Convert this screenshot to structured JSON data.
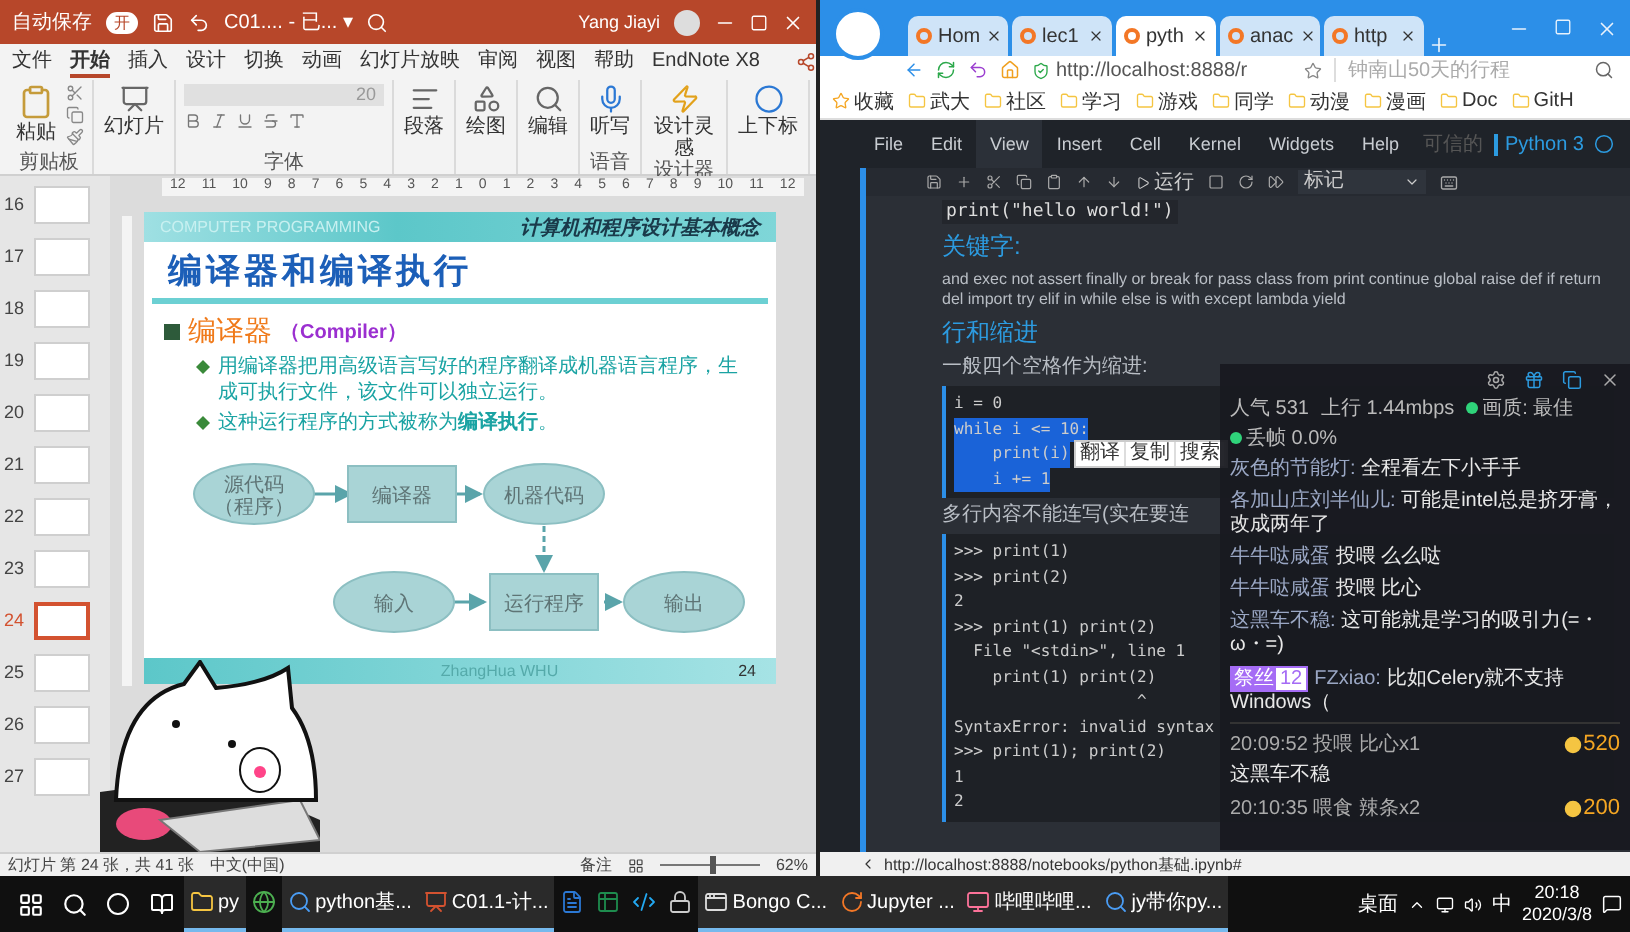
{
  "ppt": {
    "title_bar": {
      "autosave": "自动保存",
      "toggle_label": "开",
      "autosave_on": true,
      "document": "C01.... - 已... ▾",
      "user": "Yang Jiayi"
    },
    "menu_tabs": [
      {
        "label": "文件",
        "selected": false
      },
      {
        "label": "开始",
        "selected": true
      },
      {
        "label": "插入",
        "selected": false
      },
      {
        "label": "设计",
        "selected": false
      },
      {
        "label": "切换",
        "selected": false
      },
      {
        "label": "动画",
        "selected": false
      },
      {
        "label": "幻灯片放映",
        "selected": false
      },
      {
        "label": "审阅",
        "selected": false
      },
      {
        "label": "视图",
        "selected": false
      },
      {
        "label": "帮助",
        "selected": false
      },
      {
        "label": "EndNote X8",
        "selected": false
      }
    ],
    "ribbon": [
      {
        "kind": "clipboard",
        "button": "粘贴",
        "label": "剪贴板"
      },
      {
        "kind": "button",
        "button": "幻灯片"
      },
      {
        "kind": "font",
        "font_size": "20",
        "label": "字体"
      },
      {
        "kind": "button",
        "button": "段落"
      },
      {
        "kind": "button",
        "button": "绘图"
      },
      {
        "kind": "button",
        "button": "编辑"
      },
      {
        "kind": "button",
        "button": "听写",
        "label": "语音"
      },
      {
        "kind": "button",
        "button": "设计灵感",
        "label": "设计器"
      },
      {
        "kind": "button",
        "button": "上下标"
      }
    ],
    "ruler": [
      "12",
      "11",
      "10",
      "9",
      "8",
      "7",
      "6",
      "5",
      "4",
      "3",
      "2",
      "1",
      "0",
      "1",
      "2",
      "3",
      "4",
      "5",
      "6",
      "7",
      "8",
      "9",
      "10",
      "11",
      "12"
    ],
    "thumbnails": [
      {
        "number": "16",
        "selected": false
      },
      {
        "number": "17",
        "selected": false
      },
      {
        "number": "18",
        "selected": false
      },
      {
        "number": "19",
        "selected": false
      },
      {
        "number": "20",
        "selected": false
      },
      {
        "number": "21",
        "selected": false
      },
      {
        "number": "22",
        "selected": false
      },
      {
        "number": "23",
        "selected": false
      },
      {
        "number": "24",
        "selected": true
      },
      {
        "number": "25",
        "selected": false
      },
      {
        "number": "26",
        "selected": false
      },
      {
        "number": "27",
        "selected": false
      }
    ],
    "slide": {
      "banner": "COMPUTER PROGRAMMING",
      "course": "计算机和程序设计基本概念",
      "title": "编译器和编译执行",
      "heading": "编译器",
      "heading_en": "（Compiler）",
      "bullets": [
        "用编译器把用高级语言写好的程序翻译成机器语言程序，生成可执行文件，该文件可以独立运行。",
        "这种运行程序的方式被称为**编译执行**。"
      ],
      "diagram": {
        "nodes": [
          {
            "kind": "ellipse",
            "lines": [
              "源代码",
              "（程序）"
            ]
          },
          {
            "kind": "rect",
            "lines": [
              "编译器"
            ]
          },
          {
            "kind": "ellipse",
            "lines": [
              "机器代码"
            ]
          },
          {
            "kind": "ellipse",
            "lines": [
              "输入"
            ]
          },
          {
            "kind": "rect",
            "lines": [
              "运行程序"
            ]
          },
          {
            "kind": "ellipse",
            "lines": [
              "输出"
            ]
          }
        ]
      },
      "footer": "ZhangHua   WHU",
      "page": "24"
    },
    "status_bar": {
      "slide_info": "幻灯片 第 24 张，共 41 张",
      "language": "中文(中国)",
      "notes": "备注",
      "zoom": {
        "reading": "62%",
        "level": 0.5
      }
    }
  },
  "browser": {
    "tabs": [
      {
        "label": "Hom",
        "selected": false
      },
      {
        "label": "lec1",
        "selected": false
      },
      {
        "label": "pyth",
        "selected": true
      },
      {
        "label": "anac",
        "selected": false
      },
      {
        "label": "http",
        "selected": false
      }
    ],
    "url": "http://localhost:8888/r",
    "search_placeholder": "钟南山50天的行程",
    "bookmarks": [
      {
        "kind": "star",
        "label": "收藏"
      },
      {
        "kind": "folder",
        "label": "武大"
      },
      {
        "kind": "folder",
        "label": "社区"
      },
      {
        "kind": "folder",
        "label": "学习"
      },
      {
        "kind": "folder",
        "label": "游戏"
      },
      {
        "kind": "folder",
        "label": "同学"
      },
      {
        "kind": "folder",
        "label": "动漫"
      },
      {
        "kind": "folder",
        "label": "漫画"
      },
      {
        "kind": "folder",
        "label": "Doc"
      },
      {
        "kind": "folder",
        "label": "GitH"
      }
    ],
    "jupyter": {
      "menu": [
        {
          "label": "File",
          "selected": false
        },
        {
          "label": "Edit",
          "selected": false
        },
        {
          "label": "View",
          "selected": true
        },
        {
          "label": "Insert",
          "selected": false
        },
        {
          "label": "Cell",
          "selected": false
        },
        {
          "label": "Kernel",
          "selected": false
        },
        {
          "label": "Widgets",
          "selected": false
        },
        {
          "label": "Help",
          "selected": false
        }
      ],
      "trusted": "可信的",
      "kernel": "Python 3",
      "run": "运行",
      "cell_type": "标记",
      "content": [
        {
          "kind": "output",
          "text": "print(\"hello world!\")"
        },
        {
          "kind": "heading",
          "text": "关键字:"
        },
        {
          "kind": "para",
          "text": "and exec not assert finally or break for pass class from print continue global raise def if return del import try elif in while else is with except lambda yield"
        },
        {
          "kind": "heading",
          "text": "行和缩进"
        },
        {
          "kind": "para",
          "text": "一般四个空格作为缩进:"
        },
        {
          "kind": "code",
          "lines": [
            {
              "text": "i = 0",
              "selected": false
            },
            {
              "text": "while i <= 10:",
              "selected": true
            },
            {
              "text": "    print(i)",
              "selected": true
            },
            {
              "text": "    i += 1",
              "selected": true
            }
          ]
        },
        {
          "kind": "para",
          "text": "多行内容不能连写(实在要连"
        },
        {
          "kind": "code",
          "lines": [
            {
              "text": ">>> print(1)",
              "selected": false
            },
            {
              "text": ">>> print(2)",
              "selected": false
            },
            {
              "text": "2",
              "selected": false
            },
            {
              "text": ">>> print(1) print(2)",
              "selected": false
            },
            {
              "text": "  File \"<stdin>\", line 1",
              "selected": false
            },
            {
              "text": "    print(1) print(2)",
              "selected": false
            },
            {
              "text": "                   ^",
              "selected": false
            },
            {
              "text": "SyntaxError: invalid syntax",
              "selected": false
            },
            {
              "text": ">>> print(1); print(2)",
              "selected": false
            },
            {
              "text": "1",
              "selected": false
            },
            {
              "text": "2",
              "selected": false
            }
          ]
        }
      ],
      "context_menu": [
        "翻译",
        "复制",
        "搜索"
      ]
    },
    "status_url": "http://localhost:8888/notebooks/python基础.ipynb#"
  },
  "chat": {
    "stats": [
      {
        "kind": "plain",
        "text": "人气  531"
      },
      {
        "kind": "plain",
        "text": "上行  1.44mbps"
      },
      {
        "kind": "dot",
        "text": "画质: 最佳"
      },
      {
        "kind": "dot",
        "text": "丢帧 0.0%"
      }
    ],
    "messages": [
      {
        "user": "灰色的节能灯:",
        "text": "全程看左下小手手"
      },
      {
        "user": "各加山庄刘半仙儿:",
        "text": "可能是intel总是挤牙膏，改成两年了"
      },
      {
        "user": "牛牛哒咸蛋",
        "text": "投喂 么么哒"
      },
      {
        "user": "牛牛哒咸蛋",
        "text": "投喂 比心"
      },
      {
        "user": "这黑车不稳:",
        "text": "这可能就是学习的吸引力(=・ω・=)"
      },
      {
        "user": "FZxiao:",
        "text": "比如Celery就不支持Windows（",
        "medal": "祭丝",
        "medal_level": "12"
      }
    ],
    "gifts": [
      {
        "kind": "gift",
        "text": "20:09:52 投喂  比心x1",
        "amount": "520"
      },
      {
        "kind": "message",
        "text": "这黑车不稳"
      },
      {
        "kind": "gift",
        "text": "20:10:35 喂食  辣条x2",
        "amount": "200"
      }
    ]
  },
  "taskbar": {
    "apps": [
      {
        "kind": "folder",
        "label": "py"
      },
      {
        "kind": "chrome"
      },
      {
        "kind": "sogou",
        "label": "python基..."
      },
      {
        "kind": "powerpoint",
        "label": "C01.1-计..."
      },
      {
        "kind": "word"
      },
      {
        "kind": "excel"
      },
      {
        "kind": "vscode"
      },
      {
        "kind": "lock"
      },
      {
        "kind": "window",
        "label": "Bongo C..."
      },
      {
        "kind": "jupyter",
        "label": "Jupyter ..."
      },
      {
        "kind": "bilibili",
        "label": "哔哩哔哩..."
      },
      {
        "kind": "sogou",
        "label": "jy带你py..."
      }
    ],
    "desktop": "桌面",
    "ime": "中",
    "time": "20:18",
    "date": "2020/3/8"
  }
}
